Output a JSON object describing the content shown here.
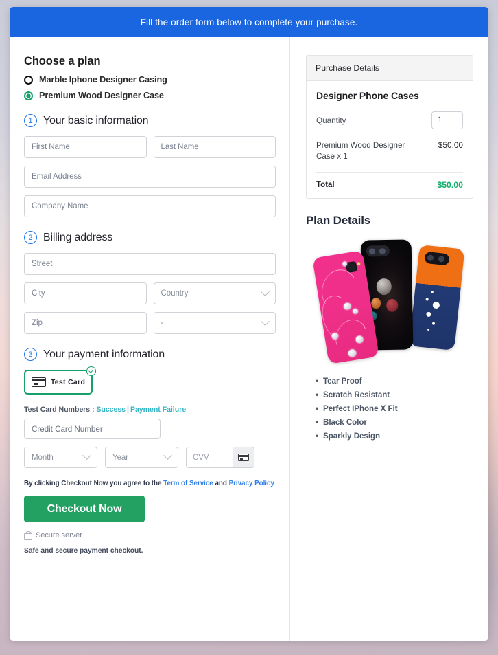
{
  "banner": {
    "message": "Fill the order form below to complete your purchase."
  },
  "plan": {
    "heading": "Choose a plan",
    "options": [
      {
        "label": "Marble Iphone Designer Casing",
        "selected": false
      },
      {
        "label": "Premium Wood Designer Case",
        "selected": true
      }
    ]
  },
  "steps": {
    "basic": {
      "number": "1",
      "title": "Your basic information"
    },
    "billing": {
      "number": "2",
      "title": "Billing address"
    },
    "payment": {
      "number": "3",
      "title": "Your payment information"
    }
  },
  "fields": {
    "first_name": "First Name",
    "last_name": "Last Name",
    "email": "Email Address",
    "company": "Company Name",
    "street": "Street",
    "city": "City",
    "country": "Country",
    "zip": "Zip",
    "state": "-",
    "credit_card_number": "Credit Card Number",
    "month": "Month",
    "year": "Year",
    "cvv": "CVV"
  },
  "payment": {
    "card_tile_label": "Test  Card",
    "test_card_prefix": "Test Card Numbers :",
    "test_card_success": "Success",
    "test_card_separator": "|",
    "test_card_failure": "Payment Failure",
    "terms_prefix": "By clicking Checkout Now you agree to the",
    "terms_link": "Term of Service",
    "terms_and": "and",
    "privacy_link": "Privacy Policy",
    "checkout_label": "Checkout Now",
    "secure_server": "Secure server",
    "safe_note": "Safe and secure payment checkout."
  },
  "purchase": {
    "panel_title": "Purchase Details",
    "product_title": "Designer Phone Cases",
    "quantity_label": "Quantity",
    "quantity_value": "1",
    "line_item_name": "Premium Wood Designer Case x 1",
    "line_item_price": "$50.00",
    "total_label": "Total",
    "total_value": "$50.00"
  },
  "plan_details": {
    "heading": "Plan Details",
    "features": [
      "Tear Proof",
      "Scratch Resistant",
      "Perfect IPhone X Fit",
      "Black Color",
      "Sparkly Design"
    ]
  },
  "colors": {
    "banner_blue": "#1a66e0",
    "step_blue": "#2277e8",
    "checkout_green": "#22a163",
    "total_green": "#13b06d",
    "radio_green": "#13a06a",
    "link_teal": "#34b4c4",
    "link_blue": "#2f7fe5"
  }
}
